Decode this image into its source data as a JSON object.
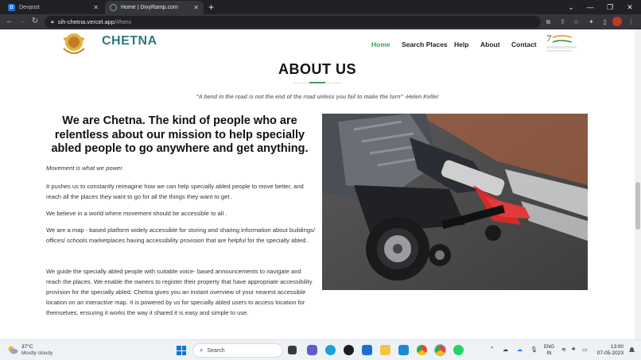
{
  "browser": {
    "tabs": [
      {
        "title": "Devpost",
        "favicon": "D"
      },
      {
        "title": "Home | DivyRamp.com",
        "favicon": "globe-icon"
      }
    ],
    "new_tab": "+",
    "url_host": "sih-chetna.vercel.app",
    "url_path": "/#hero"
  },
  "site": {
    "brand": "CHETNA",
    "logo_caption": "Chetna",
    "nav": [
      "Home",
      "Search Places",
      "Help",
      "About",
      "Contact"
    ],
    "active_nav": "Home",
    "azadi_top": "75",
    "azadi_caption": "आज़ादी का अमृत महोत्सव"
  },
  "about": {
    "title": "ABOUT US",
    "quote": "\"A bend in the road is not the end of the road unless you fail to make the turn\" -Helen Keller",
    "headline": "We are Chetna. The kind of people who are relentless about our mission to help specially abled people to go anywhere and get anything.",
    "tagline": "Movement is what we power.",
    "p1": " It pushes us to constantly reimagine how we can help specially abled people to move better, and reach all the places they want to go for all the things they want to get .",
    "p2": " We believe in a world where movement should be accessible to all .",
    "p3": " We are a map - based platform widely accessible for storing and sharing information about buildings/ offices/ schools marketplaces having accessibility provision that are helpful for the specially abled .",
    "p4": "We guide the specially abled people with suitable voice- based announcements to navigate and reach the places. We enable the owners to register their property that have appropriate accessibility provision for the specially abled. Chetna gives you an instant overview of your nearest accessible location on an interactive map. It is powered by us for specially abled users to access location for themselves, ensuring it works the way it shared it is easy and simple to use."
  },
  "taskbar": {
    "temp": "37°C",
    "weather": "Mostly cloudy",
    "search_placeholder": "Search",
    "lang1": "ENG",
    "lang2": "IN",
    "time": "13:00",
    "date": "07-05-2023"
  },
  "colors": {
    "accent_green": "#3aa35b",
    "brand_teal": "#2c7a7b",
    "chrome_dark": "#202124"
  }
}
